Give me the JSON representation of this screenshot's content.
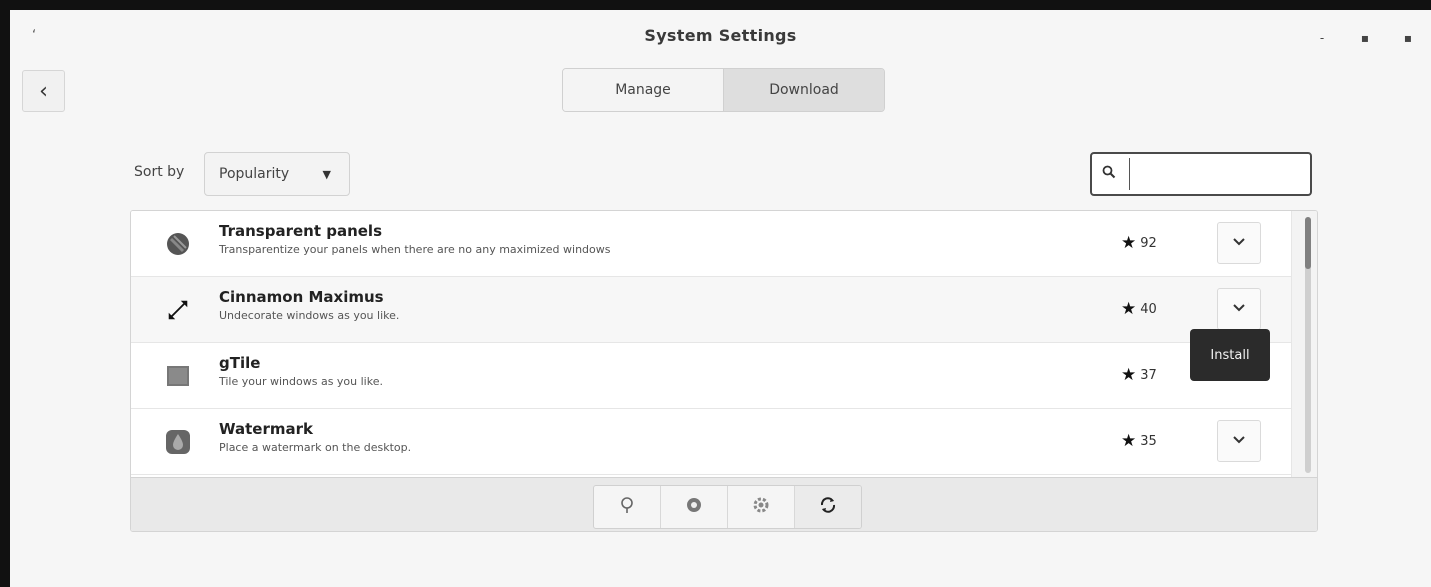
{
  "window": {
    "title": "System Settings",
    "left_glyph": "ʻ",
    "controls": {
      "minimize": "-",
      "maximize": "▪",
      "close": "▪"
    }
  },
  "header": {
    "back_icon": "‹",
    "tabs": [
      {
        "label": "Manage"
      },
      {
        "label": "Download"
      }
    ]
  },
  "sort": {
    "label": "Sort by",
    "selected": "Popularity",
    "arrow": "▼"
  },
  "search": {
    "icon": "search-icon",
    "value": ""
  },
  "applets": [
    {
      "name": "Transparent panels",
      "description": "Transparentize your panels when there are no any maximized windows",
      "score": "92",
      "icon": "transparent-panels-icon"
    },
    {
      "name": "Cinnamon Maximus",
      "description": "Undecorate windows as you like.",
      "score": "40",
      "icon": "maximize-arrows-icon"
    },
    {
      "name": "gTile",
      "description": "Tile your windows as you like.",
      "score": "37",
      "icon": "gtile-icon"
    },
    {
      "name": "Watermark",
      "description": "Place a watermark on the desktop.",
      "score": "35",
      "icon": "watermark-icon"
    }
  ],
  "tooltip": {
    "text": "Install"
  },
  "toolbar": {
    "buttons": [
      {
        "icon": "info-icon",
        "glyph": "♀"
      },
      {
        "icon": "uninstall-icon",
        "glyph": "●"
      },
      {
        "icon": "configure-icon",
        "glyph": "✲"
      },
      {
        "icon": "refresh-icon",
        "glyph": "⟳"
      }
    ]
  }
}
